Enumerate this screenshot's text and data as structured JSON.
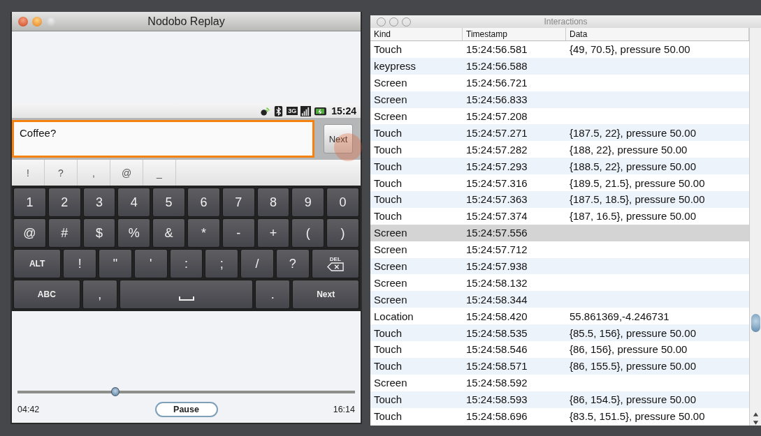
{
  "replay_window": {
    "title": "Nodobo Replay",
    "status_bar": {
      "network": "3G",
      "time": "15:24"
    },
    "text_field": {
      "value": "Coffee?"
    },
    "next_button": "Next",
    "suggestions": [
      "!",
      "?",
      ",",
      "@",
      "_"
    ],
    "keyboard": [
      [
        {
          "label": "1",
          "kind": "char"
        },
        {
          "label": "2",
          "kind": "char"
        },
        {
          "label": "3",
          "kind": "char"
        },
        {
          "label": "4",
          "kind": "char"
        },
        {
          "label": "5",
          "kind": "char"
        },
        {
          "label": "6",
          "kind": "char"
        },
        {
          "label": "7",
          "kind": "char"
        },
        {
          "label": "8",
          "kind": "char"
        },
        {
          "label": "9",
          "kind": "char"
        },
        {
          "label": "0",
          "kind": "char"
        }
      ],
      [
        {
          "label": "@",
          "kind": "char"
        },
        {
          "label": "#",
          "kind": "char"
        },
        {
          "label": "$",
          "kind": "char"
        },
        {
          "label": "%",
          "kind": "char"
        },
        {
          "label": "&",
          "kind": "char"
        },
        {
          "label": "*",
          "kind": "char"
        },
        {
          "label": "-",
          "kind": "char"
        },
        {
          "label": "+",
          "kind": "char"
        },
        {
          "label": "(",
          "kind": "char"
        },
        {
          "label": ")",
          "kind": "char"
        }
      ],
      [
        {
          "label": "ALT",
          "kind": "mod"
        },
        {
          "label": "!",
          "kind": "char"
        },
        {
          "label": "\"",
          "kind": "char"
        },
        {
          "label": "'",
          "kind": "char"
        },
        {
          "label": ":",
          "kind": "char"
        },
        {
          "label": ";",
          "kind": "char"
        },
        {
          "label": "/",
          "kind": "char"
        },
        {
          "label": "?",
          "kind": "char"
        },
        {
          "label": "DEL",
          "kind": "delete"
        }
      ],
      [
        {
          "label": "ABC",
          "kind": "action"
        },
        {
          "label": ",",
          "kind": "char"
        },
        {
          "kind": "space"
        },
        {
          "label": ".",
          "kind": "char"
        },
        {
          "label": "Next",
          "kind": "action"
        }
      ]
    ],
    "playback": {
      "level": 0.29,
      "elapsed": "04:42",
      "total": "16:14",
      "button": "Pause"
    }
  },
  "interactions_window": {
    "title": "Interactions",
    "columns": [
      "Kind",
      "Timestamp",
      "Data"
    ],
    "rows": [
      {
        "kind": "Touch",
        "timestamp": "15:24:56.581",
        "data": "{49, 70.5}, pressure 50.00",
        "selected": false
      },
      {
        "kind": "keypress",
        "timestamp": "15:24:56.588",
        "selected": false
      },
      {
        "kind": "Screen",
        "timestamp": "15:24:56.721",
        "selected": false
      },
      {
        "kind": "Screen",
        "timestamp": "15:24:56.833",
        "selected": false
      },
      {
        "kind": "Screen",
        "timestamp": "15:24:57.208",
        "selected": false
      },
      {
        "kind": "Touch",
        "timestamp": "15:24:57.271",
        "data": "{187.5, 22}, pressure 50.00",
        "selected": false
      },
      {
        "kind": "Touch",
        "timestamp": "15:24:57.282",
        "data": "{188, 22}, pressure 50.00",
        "selected": false
      },
      {
        "kind": "Touch",
        "timestamp": "15:24:57.293",
        "data": "{188.5, 22}, pressure 50.00",
        "selected": false
      },
      {
        "kind": "Touch",
        "timestamp": "15:24:57.316",
        "data": "{189.5, 21.5}, pressure 50.00",
        "selected": false
      },
      {
        "kind": "Touch",
        "timestamp": "15:24:57.363",
        "data": "{187.5, 18.5}, pressure 50.00",
        "selected": false
      },
      {
        "kind": "Touch",
        "timestamp": "15:24:57.374",
        "data": "{187, 16.5}, pressure 50.00",
        "selected": false
      },
      {
        "kind": "Screen",
        "timestamp": "15:24:57.556",
        "selected": true
      },
      {
        "kind": "Screen",
        "timestamp": "15:24:57.712",
        "selected": false
      },
      {
        "kind": "Screen",
        "timestamp": "15:24:57.938",
        "selected": false
      },
      {
        "kind": "Screen",
        "timestamp": "15:24:58.132",
        "selected": false
      },
      {
        "kind": "Screen",
        "timestamp": "15:24:58.344",
        "selected": false
      },
      {
        "kind": "Location",
        "timestamp": "15:24:58.420",
        "data": "55.861369,-4.246731",
        "selected": false
      },
      {
        "kind": "Touch",
        "timestamp": "15:24:58.535",
        "data": "{85.5, 156}, pressure 50.00",
        "selected": false
      },
      {
        "kind": "Touch",
        "timestamp": "15:24:58.546",
        "data": "{86, 156}, pressure 50.00",
        "selected": false
      },
      {
        "kind": "Touch",
        "timestamp": "15:24:58.571",
        "data": "{86, 155.5}, pressure 50.00",
        "selected": false
      },
      {
        "kind": "Screen",
        "timestamp": "15:24:58.592",
        "selected": false
      },
      {
        "kind": "Touch",
        "timestamp": "15:24:58.593",
        "data": "{86, 154.5}, pressure 50.00",
        "selected": false
      },
      {
        "kind": "Touch",
        "timestamp": "15:24:58.696",
        "data": "{83.5, 151.5}, pressure 50.00",
        "selected": false
      }
    ]
  }
}
